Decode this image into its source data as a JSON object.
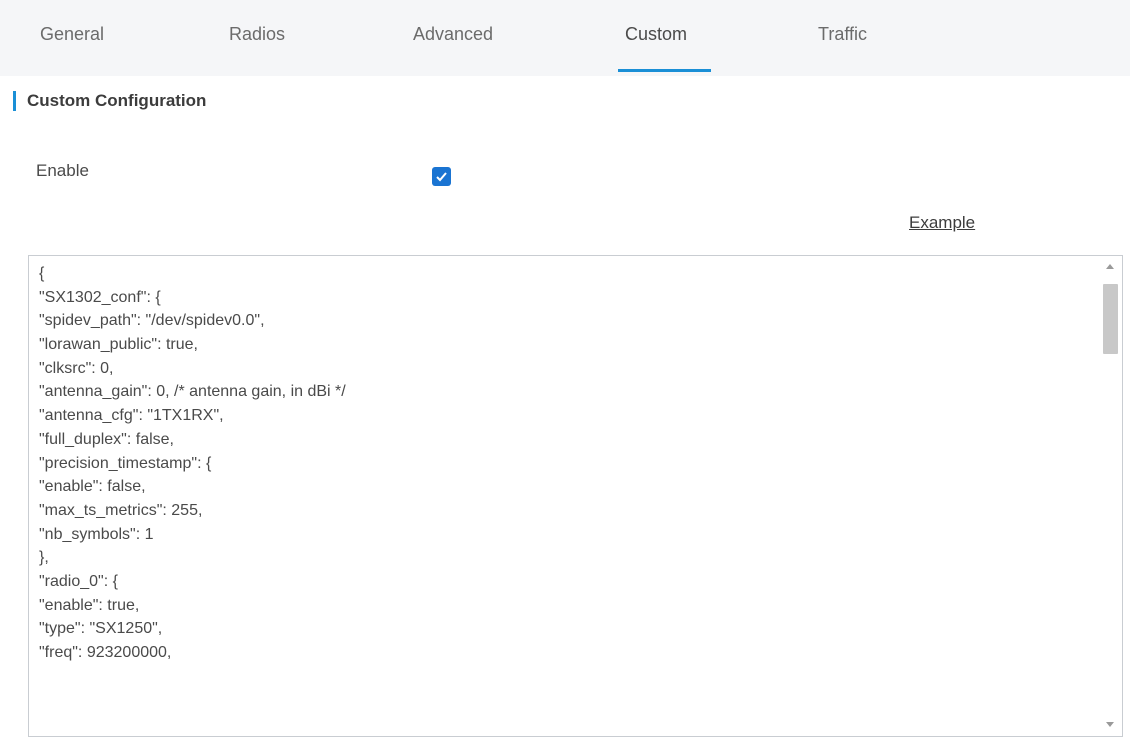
{
  "tabs": [
    {
      "label": "General",
      "active": false
    },
    {
      "label": "Radios",
      "active": false
    },
    {
      "label": "Advanced",
      "active": false
    },
    {
      "label": "Custom",
      "active": true
    },
    {
      "label": "Traffic",
      "active": false
    }
  ],
  "section": {
    "title": "Custom Configuration"
  },
  "enable": {
    "label": "Enable",
    "checked": true
  },
  "example_link": "Example",
  "config_text": {
    "lines": [
      "{",
      "\"SX1302_conf\": {",
      "\"spidev_path\": \"/dev/spidev0.0\",",
      "\"lorawan_public\": true,",
      "\"clksrc\": 0,",
      "\"antenna_gain\": 0, /* antenna gain, in dBi */",
      "\"antenna_cfg\": \"1TX1RX\",",
      "\"full_duplex\": false,",
      "\"precision_timestamp\": {",
      "\"enable\": false,",
      "\"max_ts_metrics\": 255,",
      "\"nb_symbols\": 1",
      "},",
      "\"radio_0\": {",
      "\"enable\": true,",
      "\"type\": \"SX1250\",",
      "\"freq\": 923200000,"
    ]
  },
  "colors": {
    "accent": "#1a8fd6",
    "checkbox": "#1a74d2",
    "tabbar_bg": "#f5f6f8"
  }
}
